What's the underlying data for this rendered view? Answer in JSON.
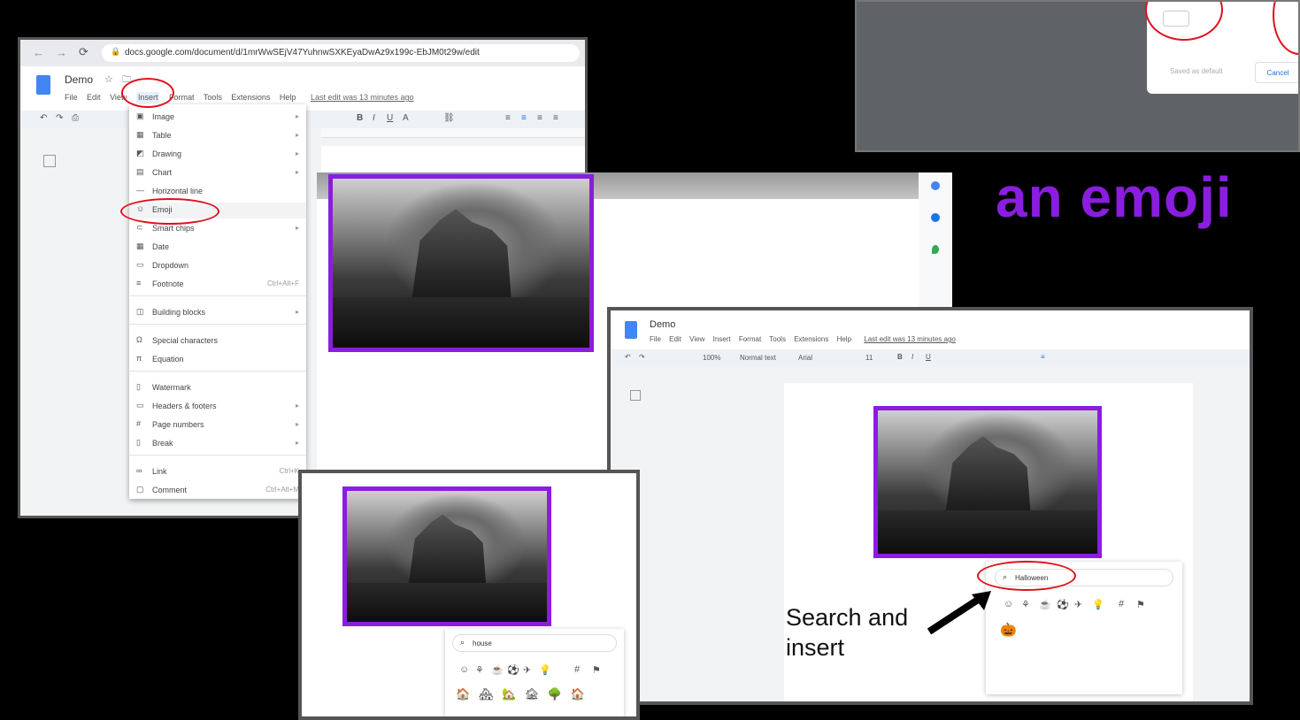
{
  "colors": {
    "accent": "#8a1de0",
    "highlight": "#e0101a",
    "docs_blue": "#4285f4"
  },
  "browser": {
    "url": "docs.google.com/document/d/1mrWwSEjV47YuhnwSXKEyaDwAz9x199c-EbJM0t29w/edit"
  },
  "doc": {
    "title": "Demo",
    "menus": [
      "File",
      "Edit",
      "View",
      "Insert",
      "Format",
      "Tools",
      "Extensions",
      "Help"
    ],
    "last_edit": "Last edit was 13 minutes ago"
  },
  "insert_menu": {
    "items": [
      {
        "icon": "image-icon",
        "label": "Image",
        "shortcut": "",
        "arrow": "▸"
      },
      {
        "icon": "table-icon",
        "label": "Table",
        "shortcut": "",
        "arrow": "▸"
      },
      {
        "icon": "drawing-icon",
        "label": "Drawing",
        "shortcut": "",
        "arrow": "▸"
      },
      {
        "icon": "chart-icon",
        "label": "Chart",
        "shortcut": "",
        "arrow": "▸"
      },
      {
        "icon": "horizontal-line-icon",
        "label": "Horizontal line",
        "shortcut": "",
        "arrow": ""
      },
      {
        "icon": "emoji-icon",
        "label": "Emoji",
        "shortcut": "",
        "arrow": ""
      },
      {
        "icon": "smart-chips-icon",
        "label": "Smart chips",
        "shortcut": "",
        "arrow": "▸"
      },
      {
        "icon": "date-icon",
        "label": "Date",
        "shortcut": "",
        "arrow": ""
      },
      {
        "icon": "dropdown-icon",
        "label": "Dropdown",
        "shortcut": "",
        "arrow": ""
      },
      {
        "icon": "footnote-icon",
        "label": "Footnote",
        "shortcut": "Ctrl+Alt+F",
        "arrow": ""
      },
      {
        "icon": "building-blocks-icon",
        "label": "Building blocks",
        "shortcut": "",
        "arrow": "▸"
      },
      {
        "icon": "special-characters-icon",
        "label": "Special characters",
        "shortcut": "",
        "arrow": ""
      },
      {
        "icon": "equation-icon",
        "label": "Equation",
        "shortcut": "",
        "arrow": ""
      },
      {
        "icon": "watermark-icon",
        "label": "Watermark",
        "shortcut": "",
        "arrow": ""
      },
      {
        "icon": "headers-footers-icon",
        "label": "Headers & footers",
        "shortcut": "",
        "arrow": "▸"
      },
      {
        "icon": "page-numbers-icon",
        "label": "Page numbers",
        "shortcut": "",
        "arrow": "▸"
      },
      {
        "icon": "break-icon",
        "label": "Break",
        "shortcut": "",
        "arrow": "▸"
      },
      {
        "icon": "link-icon",
        "label": "Link",
        "shortcut": "Ctrl+K",
        "arrow": ""
      },
      {
        "icon": "comment-icon",
        "label": "Comment",
        "shortcut": "Ctrl+Alt+M",
        "arrow": ""
      }
    ]
  },
  "dialog_fragment": {
    "saved_default": "Saved as default",
    "cancel": "Cancel"
  },
  "heading": {
    "text": "an emoji"
  },
  "caption": {
    "line1": "Search and",
    "line2": "insert"
  },
  "search_small": {
    "query": "house"
  },
  "search_big": {
    "query": "Halloween"
  },
  "toolbar_right": {
    "zoom": "100%",
    "style": "Normal text",
    "font": "Arial",
    "size": "11"
  },
  "emoji_categories": [
    "☺",
    "⚘",
    "☕",
    "⚽",
    "✈",
    "💡",
    "#",
    "⚑"
  ],
  "house_results": [
    "🏠",
    "🏘",
    "🏡",
    "🏚",
    "🌳",
    "🏠"
  ],
  "halloween_results": [
    "🎃"
  ]
}
